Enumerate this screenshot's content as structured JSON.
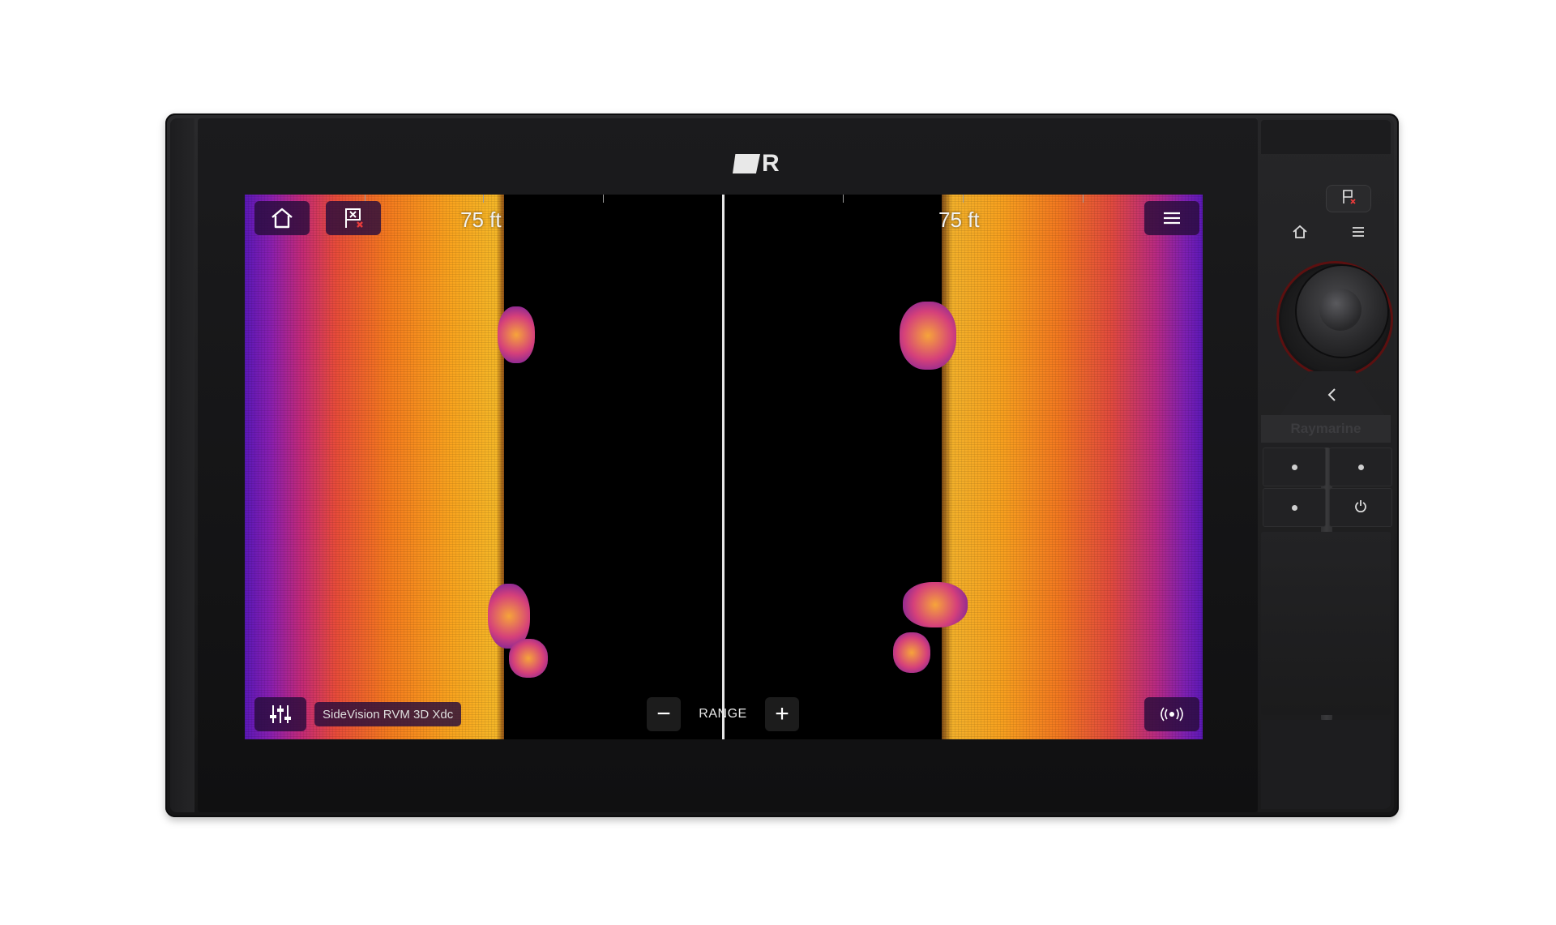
{
  "screen": {
    "range_left": "75 ft",
    "range_right": "75 ft",
    "source": "SideVision RVM 3D Xdc",
    "range_control": {
      "label": "RANGE",
      "minus": "−",
      "plus": "+"
    }
  },
  "icons": {
    "home": "home-icon",
    "waypoint": "waypoint-flag-icon",
    "menu": "hamburger-menu-icon",
    "settings": "sliders-icon",
    "transducer": "sonar-ping-icon",
    "back": "chevron-left-icon",
    "power": "power-icon"
  },
  "panel": {
    "brand": "Raymarine"
  },
  "colors": {
    "palette_low": "#5a18b8",
    "palette_mid": "#e84b3a",
    "palette_high": "#f6b727",
    "button_bg": "#280c3c",
    "bezel": "#151516"
  }
}
